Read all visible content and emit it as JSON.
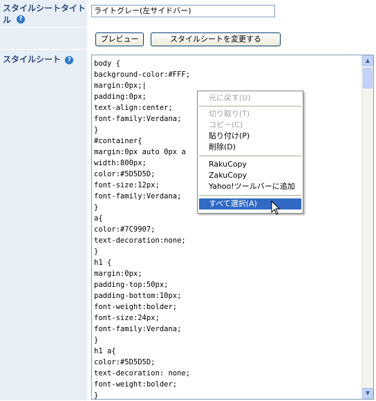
{
  "stylesheet_title": {
    "label": "スタイルシートタイトル",
    "value": "ライトグレー(左サイドバー)"
  },
  "buttons": {
    "preview": "プレビュー",
    "change": "スタイルシートを変更する"
  },
  "stylesheet": {
    "label": "スタイルシート",
    "lines": [
      "body {",
      "background-color:#FFF;",
      "margin:0px;|",
      "padding:0px;",
      "text-align:center;",
      "font-family:Verdana;",
      "}",
      "#container{",
      "margin:0px auto 0px a",
      "width:800px;",
      "color:#5D5D5D;",
      "font-size:12px;",
      "font-family:Verdana;",
      "}",
      "a{",
      "color:#7C9907;",
      "text-decoration:none;",
      "}",
      "h1 {",
      "margin:0px;",
      "padding-top:50px;",
      "padding-bottom:10px;",
      "font-weight:bolder;",
      "font-size:24px;",
      "font-family:Verdana;",
      "}",
      "h1 a{",
      "color:#5D5D5D;",
      "text-decoration: none;",
      "font-weight:bolder;",
      "}"
    ]
  },
  "context_menu": {
    "undo": "元に戻す(U)",
    "cut": "切り取り(T)",
    "copy": "コピー(C)",
    "paste": "貼り付け(P)",
    "delete": "削除(D)",
    "rakucopy": "RakuCopy",
    "zakucopy": "ZakuCopy",
    "yahoo": "Yahoo!ツールバーに追加",
    "select_all": "すべて選択(A)"
  },
  "help_icon_glyph": "?",
  "colors": {
    "label_bg": "#e8eef6",
    "label_text": "#2a4a7a",
    "menu_highlight": "#316ac5"
  }
}
